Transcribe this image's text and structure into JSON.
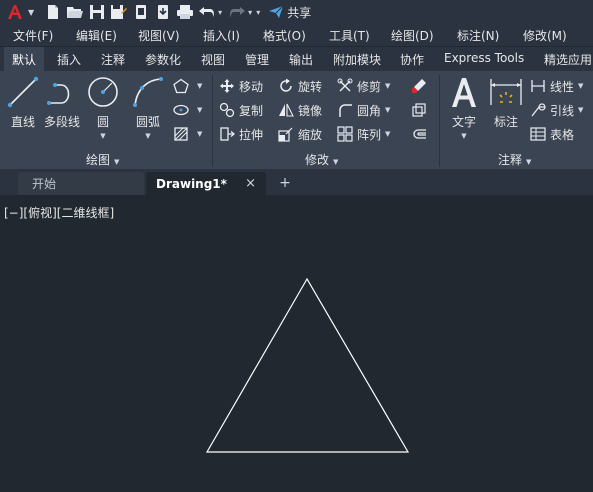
{
  "quick_access": {
    "share_label": "共享",
    "icons": [
      "new-icon",
      "open-icon",
      "save-icon",
      "save-as-icon",
      "web-mobile-open-icon",
      "web-mobile-save-icon",
      "plot-icon",
      "undo-icon",
      "redo-icon",
      "customize-icon"
    ]
  },
  "menubar": {
    "items": [
      "文件(F)",
      "编辑(E)",
      "视图(V)",
      "插入(I)",
      "格式(O)",
      "工具(T)",
      "绘图(D)",
      "标注(N)",
      "修改(M)"
    ]
  },
  "ribbon_tabs": {
    "items": [
      "默认",
      "插入",
      "注释",
      "参数化",
      "视图",
      "管理",
      "输出",
      "附加模块",
      "协作",
      "Express Tools",
      "精选应用"
    ],
    "active": "默认"
  },
  "ribbon": {
    "draw": {
      "line": "直线",
      "polyline": "多段线",
      "circle": "圆",
      "arc": "圆弧",
      "panel_title": "绘图"
    },
    "modify": {
      "move": "移动",
      "rotate": "旋转",
      "trim": "修剪",
      "copy": "复制",
      "mirror": "镜像",
      "fillet": "圆角",
      "stretch": "拉伸",
      "scale": "缩放",
      "array": "阵列",
      "panel_title": "修改"
    },
    "annotation": {
      "text": "文字",
      "dimension": "标注",
      "linear": "线性",
      "leader": "引线",
      "table": "表格",
      "panel_title": "注释"
    }
  },
  "file_tabs": {
    "start": "开始",
    "drawing": "Drawing1*",
    "close_glyph": "×",
    "add_glyph": "+"
  },
  "canvas": {
    "viewport_label": "[−][俯视][二维线框]"
  },
  "colors": {
    "canvas_bg": "#212830",
    "ribbon_bg": "#3b4453",
    "bar_bg": "#2b3340",
    "accent_red": "#e0252b",
    "icon_blue": "#4fa3e3",
    "drawing_line": "#ffffff"
  }
}
